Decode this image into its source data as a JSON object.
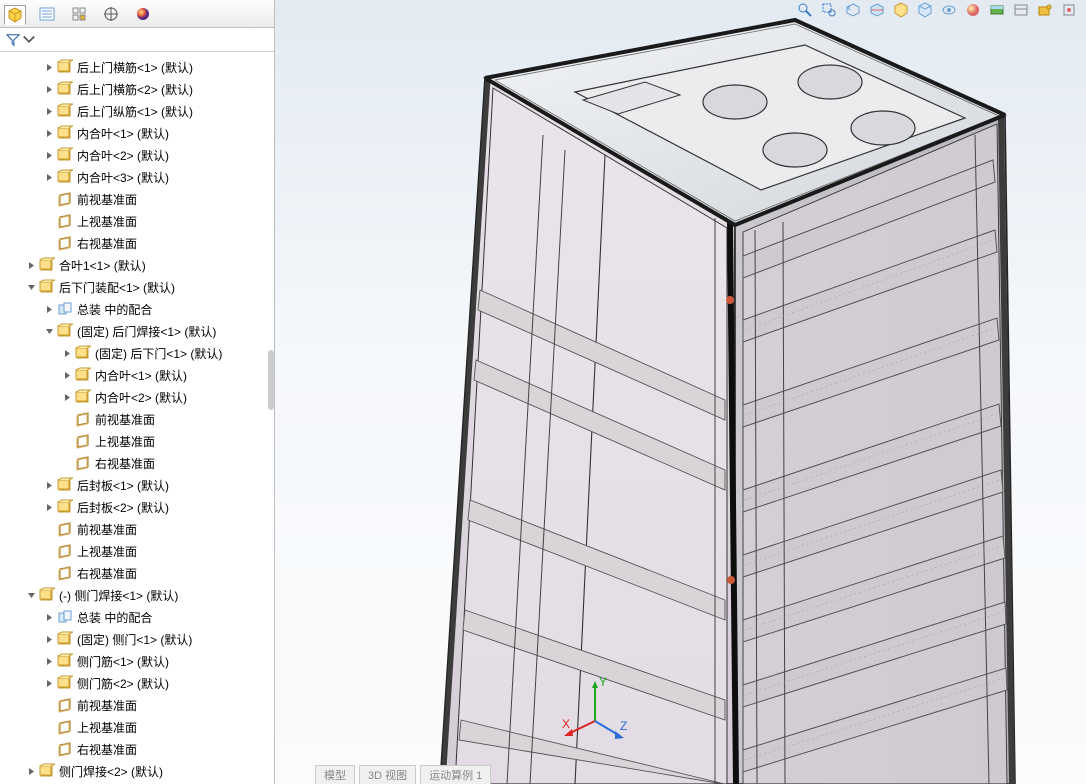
{
  "panel_tabs": {
    "feature_manager": "FeatureManager",
    "property_manager": "PropertyManager",
    "configuration_manager": "ConfigurationManager",
    "dimxpert": "DimXpertManager",
    "display_manager": "DisplayManager"
  },
  "filter": {
    "placeholder": "筛选"
  },
  "axis_labels": {
    "x": "X",
    "y": "Y",
    "z": "Z"
  },
  "bottom_tabs": [
    "模型",
    "3D 视图",
    "运动算例 1"
  ],
  "top_tools": [
    "zoom-to-fit",
    "zoom-window",
    "previous-view",
    "section-view",
    "view-orientation",
    "display-style",
    "hide-show",
    "edit-appearance",
    "apply-scene",
    "view-settings",
    "render-tools",
    "more"
  ],
  "tree": [
    {
      "d": 2,
      "e": "c",
      "i": "part",
      "t": "后上门横筋<1> (默认)"
    },
    {
      "d": 2,
      "e": "c",
      "i": "part",
      "t": "后上门横筋<2> (默认)"
    },
    {
      "d": 2,
      "e": "c",
      "i": "part",
      "t": "后上门纵筋<1> (默认)"
    },
    {
      "d": 2,
      "e": "c",
      "i": "part",
      "t": "内合叶<1> (默认)"
    },
    {
      "d": 2,
      "e": "c",
      "i": "part",
      "t": "内合叶<2> (默认)"
    },
    {
      "d": 2,
      "e": "c",
      "i": "part",
      "t": "内合叶<3> (默认)"
    },
    {
      "d": 2,
      "e": "n",
      "i": "plane",
      "t": "前视基准面"
    },
    {
      "d": 2,
      "e": "n",
      "i": "plane",
      "t": "上视基准面"
    },
    {
      "d": 2,
      "e": "n",
      "i": "plane",
      "t": "右视基准面"
    },
    {
      "d": 1,
      "e": "c",
      "i": "part",
      "t": "合叶1<1> (默认)"
    },
    {
      "d": 1,
      "e": "o",
      "i": "part",
      "t": "后下门装配<1> (默认)"
    },
    {
      "d": 2,
      "e": "c",
      "i": "mates",
      "t": "总装 中的配合"
    },
    {
      "d": 2,
      "e": "o",
      "i": "part",
      "t": "(固定) 后门焊接<1> (默认)"
    },
    {
      "d": 3,
      "e": "c",
      "i": "part",
      "t": "(固定) 后下门<1> (默认)"
    },
    {
      "d": 3,
      "e": "c",
      "i": "part",
      "t": "内合叶<1> (默认)"
    },
    {
      "d": 3,
      "e": "c",
      "i": "part",
      "t": "内合叶<2> (默认)"
    },
    {
      "d": 3,
      "e": "n",
      "i": "plane",
      "t": "前视基准面"
    },
    {
      "d": 3,
      "e": "n",
      "i": "plane",
      "t": "上视基准面"
    },
    {
      "d": 3,
      "e": "n",
      "i": "plane",
      "t": "右视基准面"
    },
    {
      "d": 2,
      "e": "c",
      "i": "part",
      "t": "后封板<1> (默认)"
    },
    {
      "d": 2,
      "e": "c",
      "i": "part",
      "t": "后封板<2> (默认)"
    },
    {
      "d": 2,
      "e": "n",
      "i": "plane",
      "t": "前视基准面"
    },
    {
      "d": 2,
      "e": "n",
      "i": "plane",
      "t": "上视基准面"
    },
    {
      "d": 2,
      "e": "n",
      "i": "plane",
      "t": "右视基准面"
    },
    {
      "d": 1,
      "e": "o",
      "i": "part",
      "t": "(-) 侧门焊接<1> (默认)"
    },
    {
      "d": 2,
      "e": "c",
      "i": "mates",
      "t": "总装 中的配合"
    },
    {
      "d": 2,
      "e": "c",
      "i": "part",
      "t": "(固定) 侧门<1> (默认)"
    },
    {
      "d": 2,
      "e": "c",
      "i": "part",
      "t": "侧门筋<1> (默认)"
    },
    {
      "d": 2,
      "e": "c",
      "i": "part",
      "t": "侧门筋<2> (默认)"
    },
    {
      "d": 2,
      "e": "n",
      "i": "plane",
      "t": "前视基准面"
    },
    {
      "d": 2,
      "e": "n",
      "i": "plane",
      "t": "上视基准面"
    },
    {
      "d": 2,
      "e": "n",
      "i": "plane",
      "t": "右视基准面"
    },
    {
      "d": 1,
      "e": "c",
      "i": "part",
      "t": "侧门焊接<2> (默认)"
    }
  ]
}
